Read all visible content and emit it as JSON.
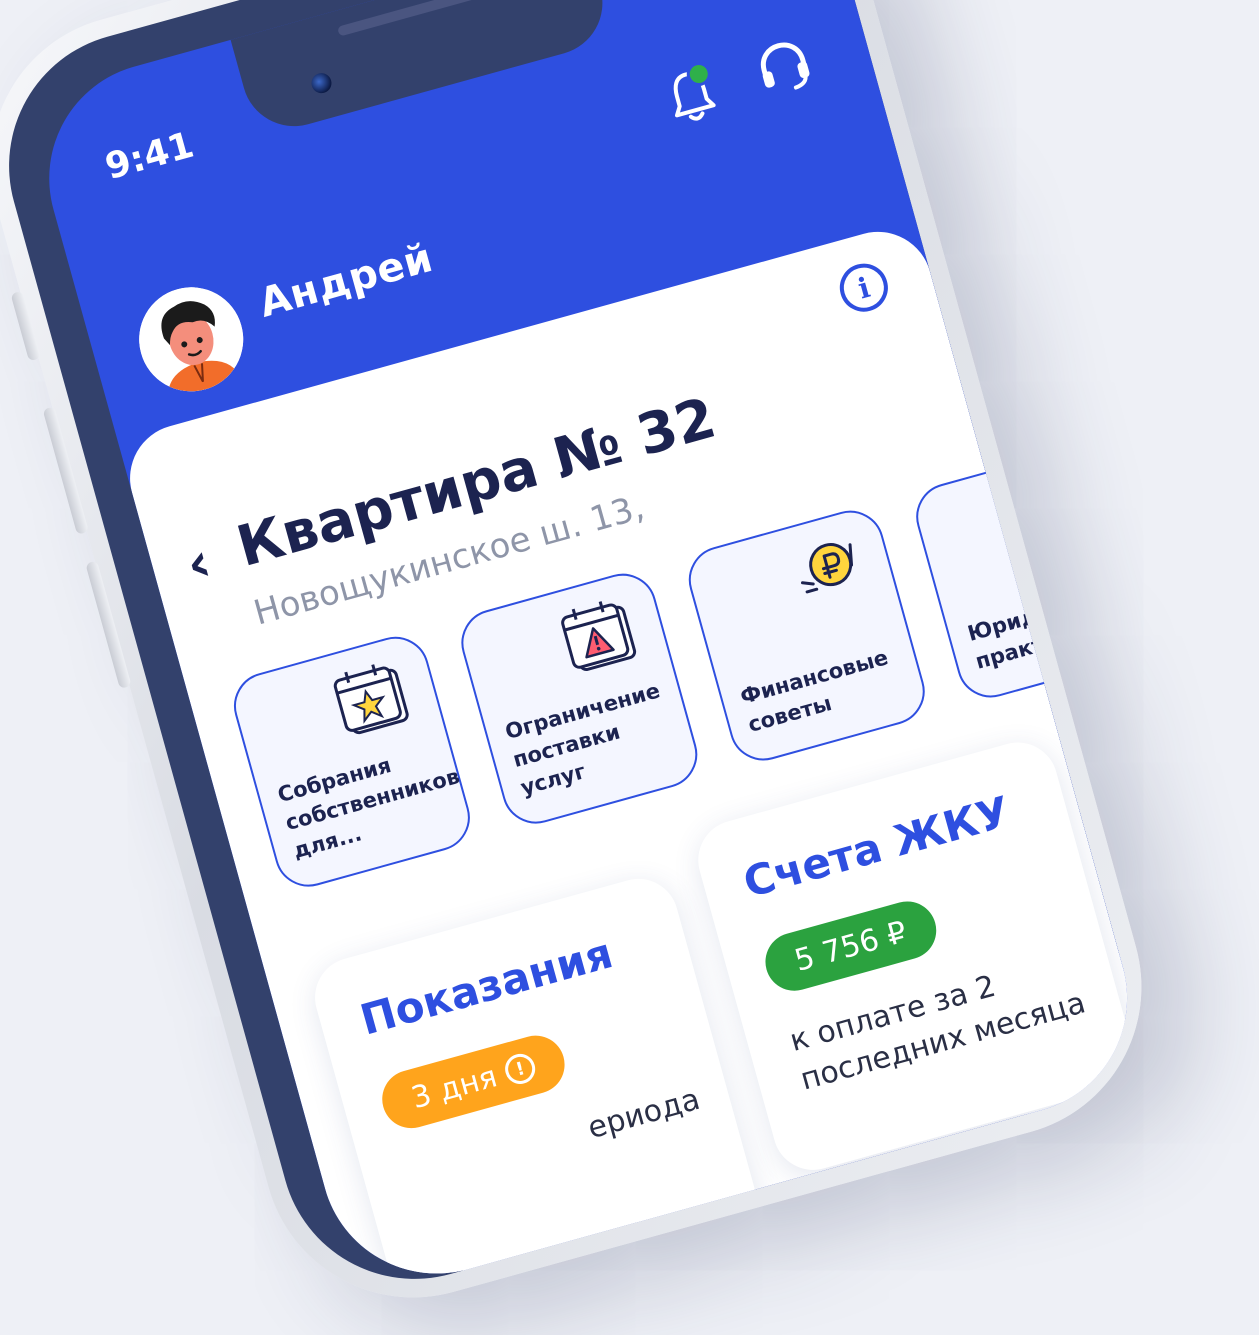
{
  "status_bar": {
    "time": "9:41"
  },
  "header": {
    "user_name": "Андрей"
  },
  "apartment": {
    "back_symbol": "‹",
    "title": "Квартира № 32",
    "address": "Новощукинское ш. 13,"
  },
  "tiles": [
    {
      "label_line1": "Собрания",
      "label_line2": "собственников",
      "label_line3": "для...",
      "icon": "calendar-star-icon"
    },
    {
      "label_line1": "Ограничение",
      "label_line2": "поставки услуг",
      "icon": "calendar-warning-icon"
    },
    {
      "label_line1": "Финансовые",
      "label_line2": "советы",
      "icon": "ruble-coin-icon"
    },
    {
      "label_line1": "Юридиче",
      "label_line2": "практики",
      "icon": "legal-icon"
    }
  ],
  "readings_card": {
    "title": "Показания",
    "badge": "3 дня",
    "badge_color": "#ffa41c",
    "subtitle": "ериода"
  },
  "bills_card": {
    "title": "Счета ЖКУ",
    "amount": "5 756 ₽",
    "amount_color": "#2ba23f",
    "note_line1": "к оплате за 2",
    "note_line2": "последних месяца"
  },
  "colors": {
    "brand_blue": "#2e4fe0",
    "frame": "#33416c",
    "notification_dot": "#2fb04a"
  }
}
